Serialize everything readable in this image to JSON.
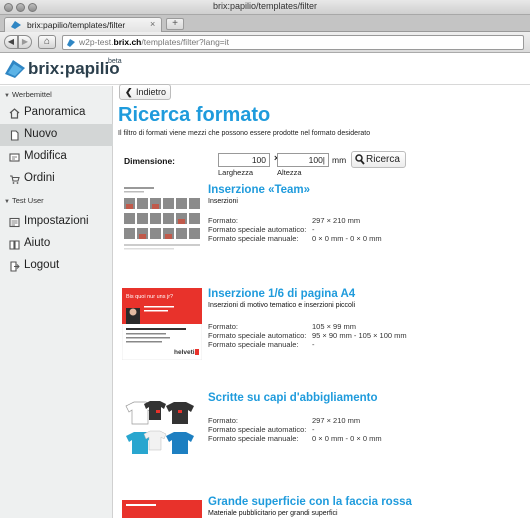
{
  "window": {
    "title": "brix:papilio/templates/filter"
  },
  "tab": {
    "label": "brix:papilio/templates/filter",
    "close": "×",
    "new_tab": "+"
  },
  "nav": {
    "back": "◀",
    "forward": "▶",
    "home": "⌂",
    "url_prefix": "w2p-test.",
    "url_domain": "brix.ch",
    "url_suffix": "/templates/filter?lang=it"
  },
  "app": {
    "logo": "brix:papilio",
    "beta": "beta"
  },
  "sidebar": {
    "section1": "Werbemittel",
    "items1": [
      {
        "label": "Panoramica",
        "icon": "house-icon"
      },
      {
        "label": "Nuovo",
        "icon": "new-document-icon",
        "active": true
      },
      {
        "label": "Modifica",
        "icon": "edit-icon"
      },
      {
        "label": "Ordini",
        "icon": "cart-icon"
      }
    ],
    "section2": "Test User",
    "items2": [
      {
        "label": "Impostazioni",
        "icon": "settings-icon"
      },
      {
        "label": "Aiuto",
        "icon": "help-book-icon"
      },
      {
        "label": "Logout",
        "icon": "logout-icon"
      }
    ]
  },
  "main": {
    "back_label": "Indietro",
    "title": "Ricerca formato",
    "subtitle": "Il filtro di formati viene mezzi che possono essere prodotte nel formato desiderato",
    "dimension_label": "Dimensione:",
    "width_value": "100",
    "height_value": "100|",
    "times": "×",
    "unit": "mm",
    "width_label": "Larghezza",
    "height_label": "Altezza",
    "search_label": "Ricerca"
  },
  "results": [
    {
      "title": "Inserzione «Team»",
      "subtitle": "Inserzioni",
      "rows": [
        {
          "label": "Formato:",
          "value": "297 × 210 mm"
        },
        {
          "label": "Formato speciale automatico:",
          "value": "-"
        },
        {
          "label": "Formato speciale manuale:",
          "value": "0 × 0 mm - 0 × 0 mm"
        }
      ]
    },
    {
      "title": "Inserzione 1/6 di pagina A4",
      "subtitle": "Inserzioni di motivo tematico e inserzioni piccoli",
      "thumb_headline": "Bis quoi nur uns jr?",
      "thumb_brand": "helvetia",
      "rows": [
        {
          "label": "Formato:",
          "value": "105 × 99 mm"
        },
        {
          "label": "Formato speciale automatico:",
          "value": "95 × 90 mm - 105 × 100 mm"
        },
        {
          "label": "Formato speciale manuale:",
          "value": "-"
        }
      ]
    },
    {
      "title": "Scritte su capi d'abbigliamento",
      "subtitle": "",
      "rows": [
        {
          "label": "Formato:",
          "value": "297 × 210 mm"
        },
        {
          "label": "Formato speciale automatico:",
          "value": "-"
        },
        {
          "label": "Formato speciale manuale:",
          "value": "0 × 0 mm - 0 × 0 mm"
        }
      ]
    },
    {
      "title": "Grande superficie con la faccia rossa",
      "subtitle": "Materiale pubblicitario per grandi superfici",
      "rows": []
    }
  ],
  "colors": {
    "accent": "#1f9bdc",
    "brand_red": "#e8322b",
    "sidebar_bg": "#eef0f0"
  }
}
